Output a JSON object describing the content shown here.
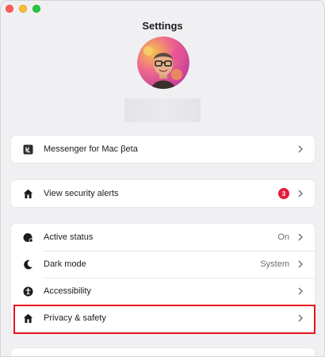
{
  "header": {
    "title": "Settings"
  },
  "profile": {
    "avatar_icon": "memoji-avatar"
  },
  "sections": {
    "messenger": {
      "label": "Messenger for Mac βeta",
      "icon": "mac-app-icon"
    },
    "security": {
      "label": "View security alerts",
      "badge": "3",
      "icon": "home-shield-icon"
    },
    "settings_list": {
      "active_status": {
        "label": "Active status",
        "value": "On",
        "icon": "active-status-icon"
      },
      "dark_mode": {
        "label": "Dark mode",
        "value": "System",
        "icon": "moon-icon"
      },
      "accessibility": {
        "label": "Accessibility",
        "icon": "accessibility-icon"
      },
      "privacy": {
        "label": "Privacy & safety",
        "icon": "home-shield-icon"
      }
    }
  },
  "colors": {
    "badge": "#e41e3f",
    "highlight": "#e8141c",
    "background": "#f0f0f2"
  }
}
